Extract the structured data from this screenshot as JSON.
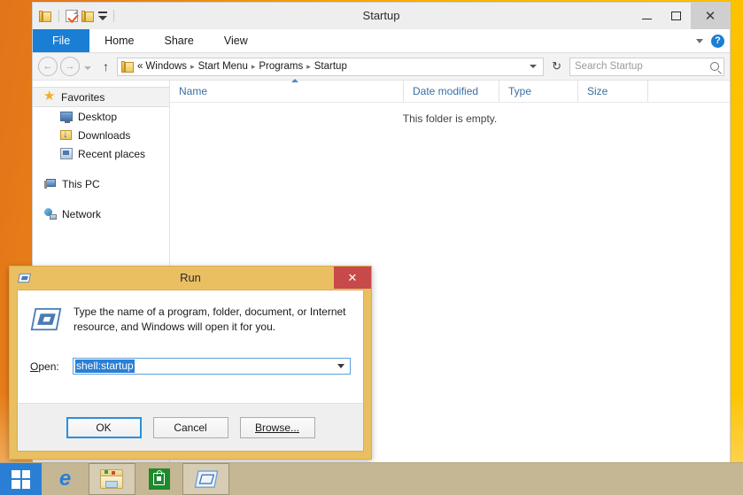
{
  "desktop": {
    "background_color": "#f3a20c"
  },
  "explorer": {
    "title": "Startup",
    "quick_access": [
      {
        "name": "folder-icon",
        "label": "Startup folder"
      },
      {
        "name": "properties-icon",
        "label": "Properties"
      },
      {
        "name": "new-folder-icon",
        "label": "New folder"
      },
      {
        "name": "customize-caret-icon",
        "label": "Customize Quick Access Toolbar"
      }
    ],
    "window_controls": {
      "minimize": "–",
      "maximize": "□",
      "close": "✕"
    },
    "ribbon_tabs": [
      {
        "label": "File",
        "active": true
      },
      {
        "label": "Home",
        "active": false
      },
      {
        "label": "Share",
        "active": false
      },
      {
        "label": "View",
        "active": false
      }
    ],
    "ribbon_right": {
      "expand_label": "˅",
      "help_label": "?"
    },
    "address_bar": {
      "back_label": "←",
      "forward_label": "→",
      "recent_label": "˅",
      "up_label": "↑",
      "refresh_label": "↻",
      "breadcrumb_prefix": "«",
      "breadcrumbs": [
        "Windows",
        "Start Menu",
        "Programs",
        "Startup"
      ],
      "separator": "▸"
    },
    "search": {
      "placeholder": "Search Startup",
      "value": ""
    },
    "nav_pane": {
      "groups": [
        {
          "header": {
            "label": "Favorites",
            "icon": "star-icon",
            "selected": true
          },
          "items": [
            {
              "label": "Desktop",
              "icon": "desktop-icon"
            },
            {
              "label": "Downloads",
              "icon": "downloads-icon"
            },
            {
              "label": "Recent places",
              "icon": "recent-places-icon"
            }
          ]
        },
        {
          "header": {
            "label": "This PC",
            "icon": "this-pc-icon",
            "selected": false
          },
          "items": []
        },
        {
          "header": {
            "label": "Network",
            "icon": "network-icon",
            "selected": false
          },
          "items": []
        }
      ]
    },
    "file_list": {
      "columns": [
        "Name",
        "Date modified",
        "Type",
        "Size"
      ],
      "sorted_by": "Name",
      "sort_direction": "ascending",
      "rows": [],
      "empty_message": "This folder is empty."
    }
  },
  "run_dialog": {
    "title": "Run",
    "close_label": "✕",
    "description": "Type the name of a program, folder, document, or Internet resource, and Windows will open it for you.",
    "open_label_prefix": "O",
    "open_label_rest": "pen:",
    "input_value": "shell:startup",
    "input_selected": true,
    "dropdown_arrow": "˅",
    "buttons": [
      {
        "label": "OK",
        "default": true
      },
      {
        "label": "Cancel",
        "default": false
      },
      {
        "label": "Browse...",
        "default": false,
        "accelerator": "B"
      }
    ]
  },
  "taskbar": {
    "start_label": "Start",
    "items": [
      {
        "name": "internet-explorer",
        "label": "Internet Explorer",
        "glyph": "e",
        "active": false
      },
      {
        "name": "file-explorer",
        "label": "File Explorer",
        "active": true
      },
      {
        "name": "store",
        "label": "Store",
        "active": false
      },
      {
        "name": "run-dialog",
        "label": "Run",
        "active": true
      }
    ]
  }
}
